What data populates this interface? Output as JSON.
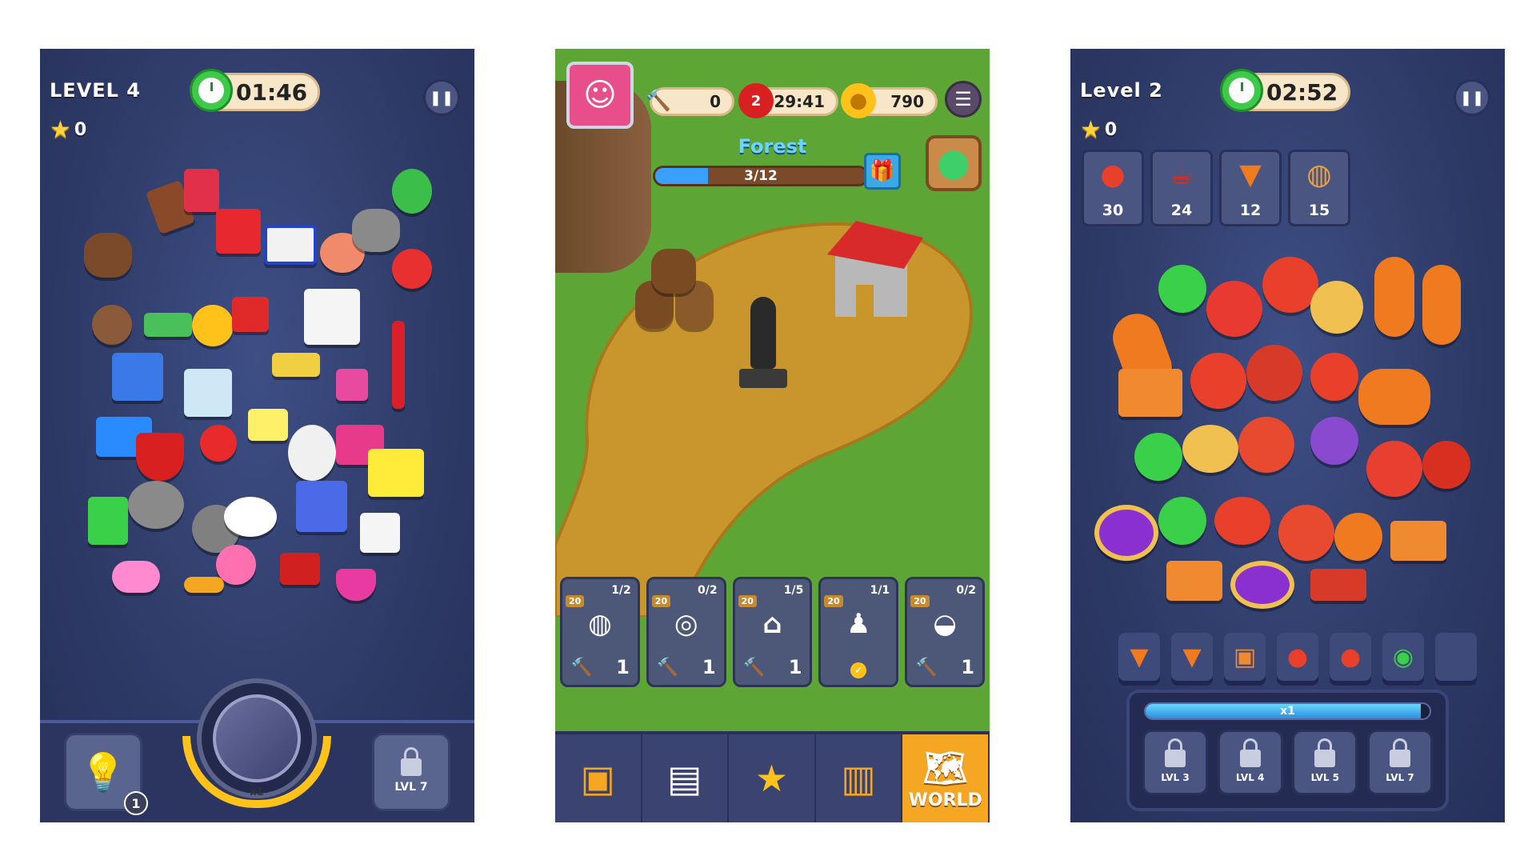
{
  "screen1": {
    "level_label": "LEVEL 4",
    "stars": "0",
    "timer": "01:46",
    "pause_icon": "pause-icon",
    "hint_count": "1",
    "magnet_multiplier": "x1",
    "locked_booster_label": "LVL 7"
  },
  "screen2": {
    "hammers": "0",
    "lives": "2",
    "lives_timer": "29:41",
    "coins": "790",
    "area_name": "Forest",
    "area_progress_text": "3/12",
    "area_progress": 0.25,
    "cards": [
      {
        "reward": "20",
        "count": "1/2",
        "art": "barrels",
        "cost": "1",
        "done": false
      },
      {
        "reward": "20",
        "count": "0/2",
        "art": "cart",
        "cost": "1",
        "done": false
      },
      {
        "reward": "20",
        "count": "1/5",
        "art": "house",
        "cost": "1",
        "done": false
      },
      {
        "reward": "20",
        "count": "1/1",
        "art": "statue",
        "cost": "",
        "done": true
      },
      {
        "reward": "20",
        "count": "0/2",
        "art": "well",
        "cost": "1",
        "done": false
      }
    ],
    "nav": {
      "world_label": "WORLD"
    }
  },
  "screen3": {
    "level_label": "Level 2",
    "stars": "0",
    "timer": "02:52",
    "goals": [
      {
        "icon": "red-disc",
        "count": "30"
      },
      {
        "icon": "mug",
        "count": "24"
      },
      {
        "icon": "carrot",
        "count": "12"
      },
      {
        "icon": "pie",
        "count": "15"
      }
    ],
    "combo_text": "x1",
    "combo_progress": 0.97,
    "locked_boosters": [
      "LVL 3",
      "LVL 4",
      "LVL 5",
      "LVL 7"
    ]
  },
  "colors": {
    "hud_bg": "#2e3a66",
    "timer_green": "#3ec94a",
    "star_yellow": "#ffd23c",
    "forest_title": "#6ad6ff",
    "world_orange": "#f5a623"
  }
}
